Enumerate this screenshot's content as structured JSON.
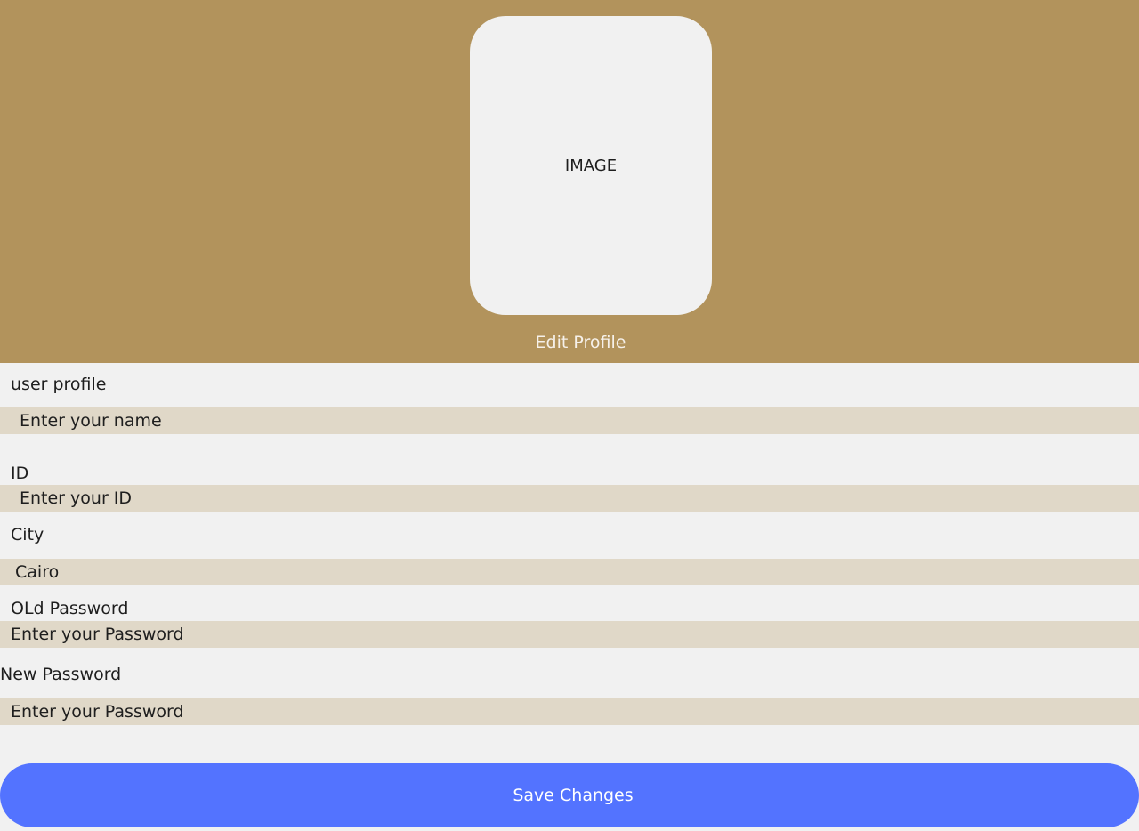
{
  "header": {
    "image_placeholder": "IMAGE",
    "edit_profile": "Edit Profile"
  },
  "form": {
    "name": {
      "label": "user profile",
      "placeholder": "Enter your name"
    },
    "id": {
      "label": "ID",
      "placeholder": "Enter your ID"
    },
    "city": {
      "label": "City",
      "value": "Cairo"
    },
    "old_password": {
      "label": "OLd Password",
      "placeholder": "Enter your Password"
    },
    "new_password": {
      "label": "New Password",
      "placeholder": "Enter your Password"
    },
    "save_label": "Save Changes"
  },
  "colors": {
    "header_bg": "#b2935c",
    "field_bg": "#e0d8c8",
    "button_bg": "#5373ff",
    "page_bg": "#f1f1f1"
  }
}
